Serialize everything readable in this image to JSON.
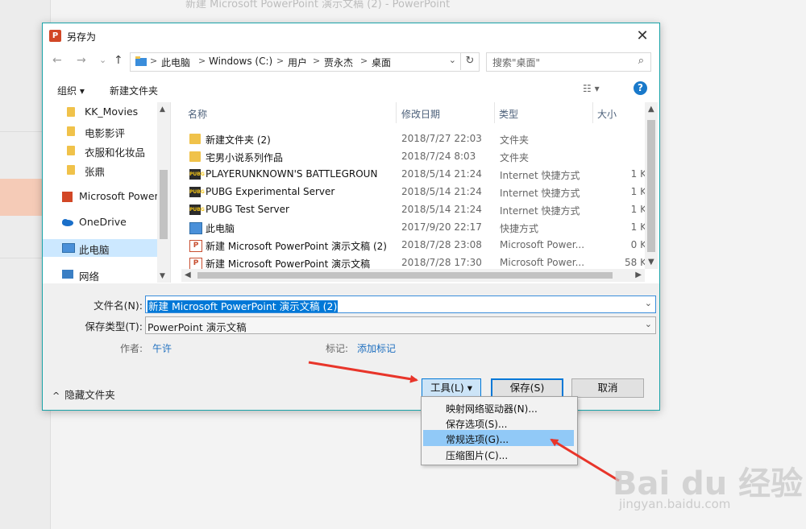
{
  "background": {
    "window_title": "新建 Microsoft PowerPoint 演示文稿 (2)  -  PowerPoint"
  },
  "dialog": {
    "title": "另存为",
    "app_icon_letter": "P",
    "close_glyph": "✕",
    "nav": {
      "back_glyph": "←",
      "forward_glyph": "→",
      "recent_glyph": "⌄",
      "up_glyph": "↑",
      "breadcrumb": [
        "此电脑",
        "Windows (C:)",
        "用户",
        "贾永杰",
        "桌面"
      ],
      "breadcrumb_sep": ">",
      "dropdown_glyph": "⌄",
      "refresh_glyph": "↻",
      "search_placeholder": "搜索\"桌面\"",
      "search_glyph": "⌕"
    },
    "commands": {
      "organize": "组织 ▾",
      "new_folder": "新建文件夹",
      "view_glyph": "☷ ▾",
      "help_glyph": "?"
    },
    "nav_pane": {
      "items": [
        {
          "label": "KK_Movies",
          "icon": "folder-icon"
        },
        {
          "label": "电影影评",
          "icon": "folder-icon"
        },
        {
          "label": "衣服和化妆品",
          "icon": "folder-icon"
        },
        {
          "label": "张鼎",
          "icon": "folder-icon"
        },
        {
          "label": "Microsoft PowerPoint",
          "icon": "powerpoint-icon"
        },
        {
          "label": "OneDrive",
          "icon": "onedrive-icon"
        },
        {
          "label": "此电脑",
          "icon": "computer-icon",
          "selected": true
        },
        {
          "label": "网络",
          "icon": "network-icon"
        }
      ]
    },
    "file_list": {
      "columns": [
        "名称",
        "修改日期",
        "类型",
        "大小"
      ],
      "sort_glyph": "^",
      "rows": [
        {
          "name": "新建文件夹 (2)",
          "date": "2018/7/27 22:03",
          "type": "文件夹",
          "size": "",
          "icon": "folder"
        },
        {
          "name": "宅男小说系列作品",
          "date": "2018/7/24 8:03",
          "type": "文件夹",
          "size": "",
          "icon": "folder"
        },
        {
          "name": "PLAYERUNKNOWN'S BATTLEGROUN",
          "date": "2018/5/14 21:24",
          "type": "Internet 快捷方式",
          "size": "1 K",
          "icon": "pubg"
        },
        {
          "name": "PUBG Experimental Server",
          "date": "2018/5/14 21:24",
          "type": "Internet 快捷方式",
          "size": "1 K",
          "icon": "pubg"
        },
        {
          "name": "PUBG Test Server",
          "date": "2018/5/14 21:24",
          "type": "Internet 快捷方式",
          "size": "1 K",
          "icon": "pubg"
        },
        {
          "name": "此电脑",
          "date": "2017/9/20 22:17",
          "type": "快捷方式",
          "size": "1 K",
          "icon": "pc"
        },
        {
          "name": "新建 Microsoft PowerPoint 演示文稿 (2)",
          "date": "2018/7/28 23:08",
          "type": "Microsoft Power...",
          "size": "0 K",
          "icon": "ppt"
        },
        {
          "name": "新建 Microsoft PowerPoint 演示文稿",
          "date": "2018/7/28 17:30",
          "type": "Microsoft Power...",
          "size": "58 K",
          "icon": "ppt"
        }
      ]
    },
    "form": {
      "filename_label": "文件名(N):",
      "filename_value": "新建 Microsoft PowerPoint 演示文稿 (2)",
      "filetype_label": "保存类型(T):",
      "filetype_value": "PowerPoint 演示文稿",
      "author_label": "作者:",
      "author_value": "午许",
      "tags_label": "标记:",
      "tags_value": "添加标记",
      "dropdown_glyph": "⌄"
    },
    "buttons": {
      "tools": "工具(L)  ▾",
      "save": "保存(S)",
      "cancel": "取消",
      "hide_folders": "隐藏文件夹",
      "hide_folders_glyph": "^"
    }
  },
  "tools_menu": {
    "items": [
      {
        "label": "映射网络驱动器(N)...",
        "highlighted": false
      },
      {
        "label": "保存选项(S)...",
        "highlighted": false
      },
      {
        "label": "常规选项(G)...",
        "highlighted": true
      },
      {
        "label": "压缩图片(C)...",
        "highlighted": false
      }
    ]
  },
  "watermark": {
    "brand": "Bai du 经验",
    "url": "jingyan.baidu.com"
  },
  "colors": {
    "accent": "#0078d7",
    "dialog_border": "#1aa3a8",
    "arrow": "#e8352a",
    "menu_highlight": "#91c9f7"
  }
}
